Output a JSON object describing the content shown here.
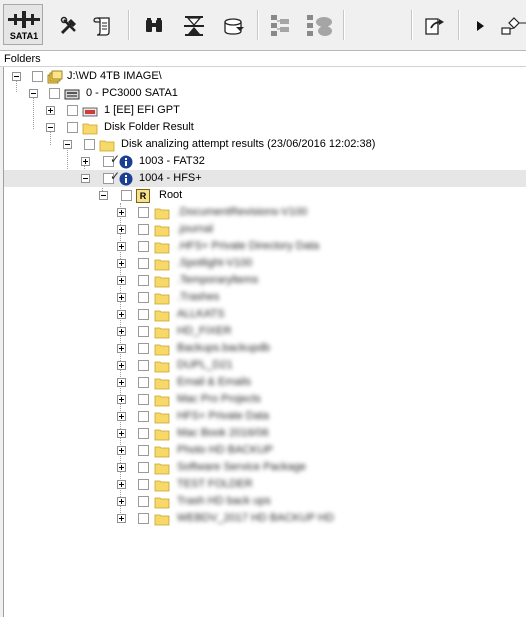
{
  "toolbar": {
    "device_label": "SATA1",
    "icons": [
      "sata-device-icon",
      "tools-icon",
      "script-icon",
      "binoculars-icon",
      "hourglass-icon",
      "disk-save-icon",
      "tree-list-icon",
      "tree-cluster-icon",
      "export-icon",
      "play-icon",
      "workflow-icon"
    ]
  },
  "panel": {
    "header": "Folders"
  },
  "tree": {
    "root_drive": "J:\\WD 4TB IMAGE\\",
    "device": "0 - PC3000 SATA1",
    "partition": "1 [EE] EFI GPT",
    "disk_folder": "Disk Folder Result",
    "analysis": "Disk analizing attempt results (23/06/2016 12:02:38)",
    "volumes": [
      {
        "label": "1003 - FAT32"
      },
      {
        "label": "1004 - HFS+"
      }
    ],
    "root_label": "Root",
    "root_badge": "R",
    "folders": [
      ".DocumentRevisions-V100",
      ".journal",
      ".HFS+ Private Directory Data",
      ".Spotlight-V100",
      ".Temporaryltems",
      ".Trashes",
      "ALLKATS",
      "HD_FIXER",
      "Backups.backupdb",
      "DUPL_D21",
      "Email & Emails",
      "Mac Pro Projects",
      "HFS+ Private Data",
      "Mac Book 2016/06",
      "Photo HD BACKUP",
      "Software Service Package",
      "TEST FOLDER",
      "Trash HD back ups",
      "WEBDV_2017 HD BACKUP HD"
    ]
  },
  "colors": {
    "folder": "#f7d96a",
    "folder_edge": "#c9a227",
    "info": "#1c3f94",
    "highlight": "#e6e6e6"
  }
}
